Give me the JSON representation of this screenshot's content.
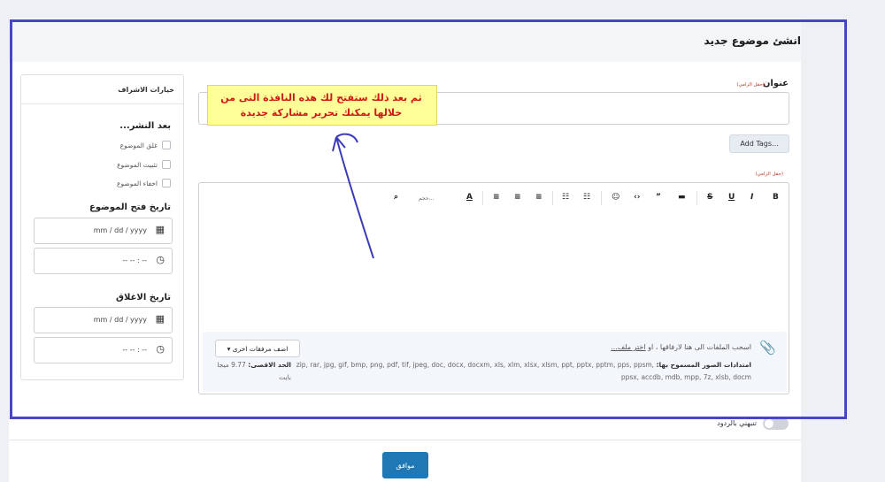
{
  "page": {
    "title": "انشئ موضوع جديد"
  },
  "sidebar": {
    "title": "خيارات الاشراف",
    "after_publish": "بعد النشر...",
    "checkboxes": [
      "غلق الموضوع",
      "تثبيت الموضوع",
      "اخفاء الموضوع"
    ],
    "open_date_label": "تاريخ فتح الموضوع",
    "close_date_label": "تاريخ الاغلاق",
    "date_placeholder": "mm / dd / yyyy",
    "time_placeholder": "-- -- : --"
  },
  "form": {
    "title_label": "عنوان",
    "required": "(حقل الزامي)",
    "add_tags": "Add Tags...",
    "editor_required": "(حقل الزامي)"
  },
  "toolbar": {
    "bold": "B",
    "italic": "I",
    "underline": "U",
    "strike": "S",
    "font_color": "A",
    "font_size": "حجم...",
    "search": "⌕"
  },
  "attachments": {
    "drop_text_prefix": "اسحب الملفات الى هنا لارفاقها ، او",
    "browse_link": "اختر ملف...",
    "allowed_label": "امتدادات الصور المسموح بها:",
    "allowed_list": "zip, rar, jpg, gif, bmp, png, pdf, tif, jpeg, doc, docx, docxm, xls, xlm, xlsx, xlsm, ppt, pptx, pptm, pps, ppsm, ppsx, accdb, mdb, mpp, 7z, xlsb, docm",
    "add_more": "اضف مرفقات اخرى",
    "max_label": "الحد الاقصى:",
    "max_value": "9.77 ميجا بايت"
  },
  "callout": {
    "text": "ثم بعد ذلك ستفتح لك هذه النافذة التى من خلالها يمكنك تحرير مشاركة جديدة"
  },
  "footer": {
    "toggle_label": "تنبهني بالردود",
    "submit": "موافق"
  },
  "colors": {
    "frame": "#4747c4",
    "callout_bg": "#ffff99",
    "callout_text": "#d01818",
    "primary": "#1f78b4"
  }
}
